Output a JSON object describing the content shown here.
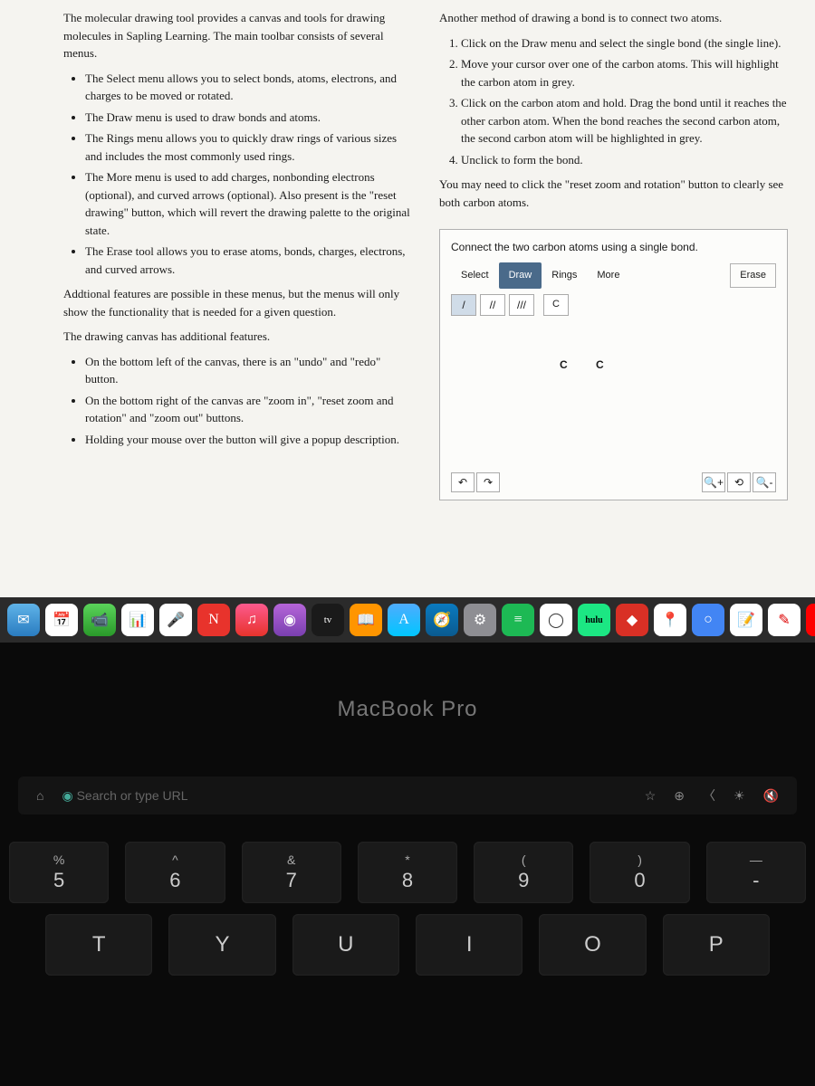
{
  "left": {
    "intro": "The molecular drawing tool provides a canvas and tools for drawing molecules in Sapling Learning. The main toolbar consists of several menus.",
    "menu_items": [
      "The Select menu allows you to select bonds, atoms, electrons, and charges to be moved or rotated.",
      "The Draw menu is used to draw bonds and atoms.",
      "The Rings menu allows you to quickly draw rings of various sizes and includes the most commonly used rings.",
      "The More menu is used to add charges, nonbonding electrons (optional), and curved arrows (optional). Also present is the \"reset drawing\" button, which will revert the drawing palette to the original state.",
      "The Erase tool allows you to erase atoms, bonds, charges, electrons, and curved arrows."
    ],
    "addl": "Addtional features are possible in these menus, but the menus will only show the functionality that is needed for a given question.",
    "canvas_intro": "The drawing canvas has additional features.",
    "canvas_items": [
      "On the bottom left of the canvas, there is an \"undo\" and \"redo\" button.",
      "On the bottom right of the canvas are \"zoom in\", \"reset zoom and rotation\" and \"zoom out\" buttons.",
      "Holding your mouse over the button will give a popup description."
    ]
  },
  "right": {
    "intro": "Another method of drawing a bond is to connect two atoms.",
    "steps": [
      "Click on the Draw menu and select the single bond (the single line).",
      "Move your cursor over one of the carbon atoms. This will highlight the carbon atom in grey.",
      "Click on the carbon atom and hold. Drag the bond until it reaches the other carbon atom. When the bond reaches the second carbon atom, the second carbon atom will be highlighted in grey.",
      "Unclick to form the bond."
    ],
    "note": "You may need to click the \"reset zoom and rotation\" button to clearly see both carbon atoms."
  },
  "panel": {
    "prompt": "Connect the two carbon atoms using a single bond.",
    "tabs": {
      "select": "Select",
      "draw": "Draw",
      "rings": "Rings",
      "more": "More"
    },
    "erase": "Erase",
    "bonds": {
      "single": "/",
      "double": "//",
      "triple": "///"
    },
    "atom_btn": "C",
    "atoms": {
      "c1": "C",
      "c2": "C"
    },
    "undo": "↶",
    "redo": "↷",
    "zoom_in": "⊕",
    "reset_zoom": "⟳",
    "zoom_out": "⊖"
  },
  "dock": {
    "hulu": "hulu",
    "tv": "tv"
  },
  "laptop": {
    "label": "MacBook Pro",
    "url_placeholder": "Search or type URL"
  },
  "keys": {
    "r1": [
      {
        "s": "%",
        "m": "5"
      },
      {
        "s": "^",
        "m": "6"
      },
      {
        "s": "&",
        "m": "7"
      },
      {
        "s": "*",
        "m": "8"
      },
      {
        "s": "(",
        "m": "9"
      },
      {
        "s": ")",
        "m": "0"
      },
      {
        "s": "—",
        "m": "-"
      }
    ],
    "r2": [
      "T",
      "Y",
      "U",
      "I",
      "O",
      "P"
    ]
  }
}
